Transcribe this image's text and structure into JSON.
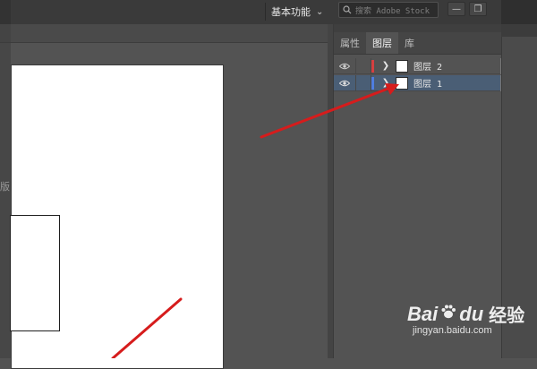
{
  "topbar": {
    "workspace_label": "基本功能",
    "workspace_chevron": "⌄",
    "search_placeholder": "搜索 Adobe Stock",
    "minimize_glyph": "—",
    "restore_glyph": "❐"
  },
  "panel": {
    "tabs": [
      {
        "label": "属性",
        "active": false
      },
      {
        "label": "图层",
        "active": true
      },
      {
        "label": "库",
        "active": false
      }
    ],
    "layers": [
      {
        "name": "图层 2",
        "color": "#d64040",
        "selected": false
      },
      {
        "name": "图层 1",
        "color": "#4f7ee0",
        "selected": true
      }
    ]
  },
  "canvas": {
    "partial_text": "版"
  },
  "annotations": {
    "arrow_color": "#d61c1c"
  },
  "watermark": {
    "brand": "Bai",
    "brand_tail": "du",
    "brand_cn": "经验",
    "url": "jingyan.baidu.com"
  },
  "icons": [
    "search-icon",
    "eye-icon",
    "chevron-right-icon",
    "paw-icon"
  ]
}
